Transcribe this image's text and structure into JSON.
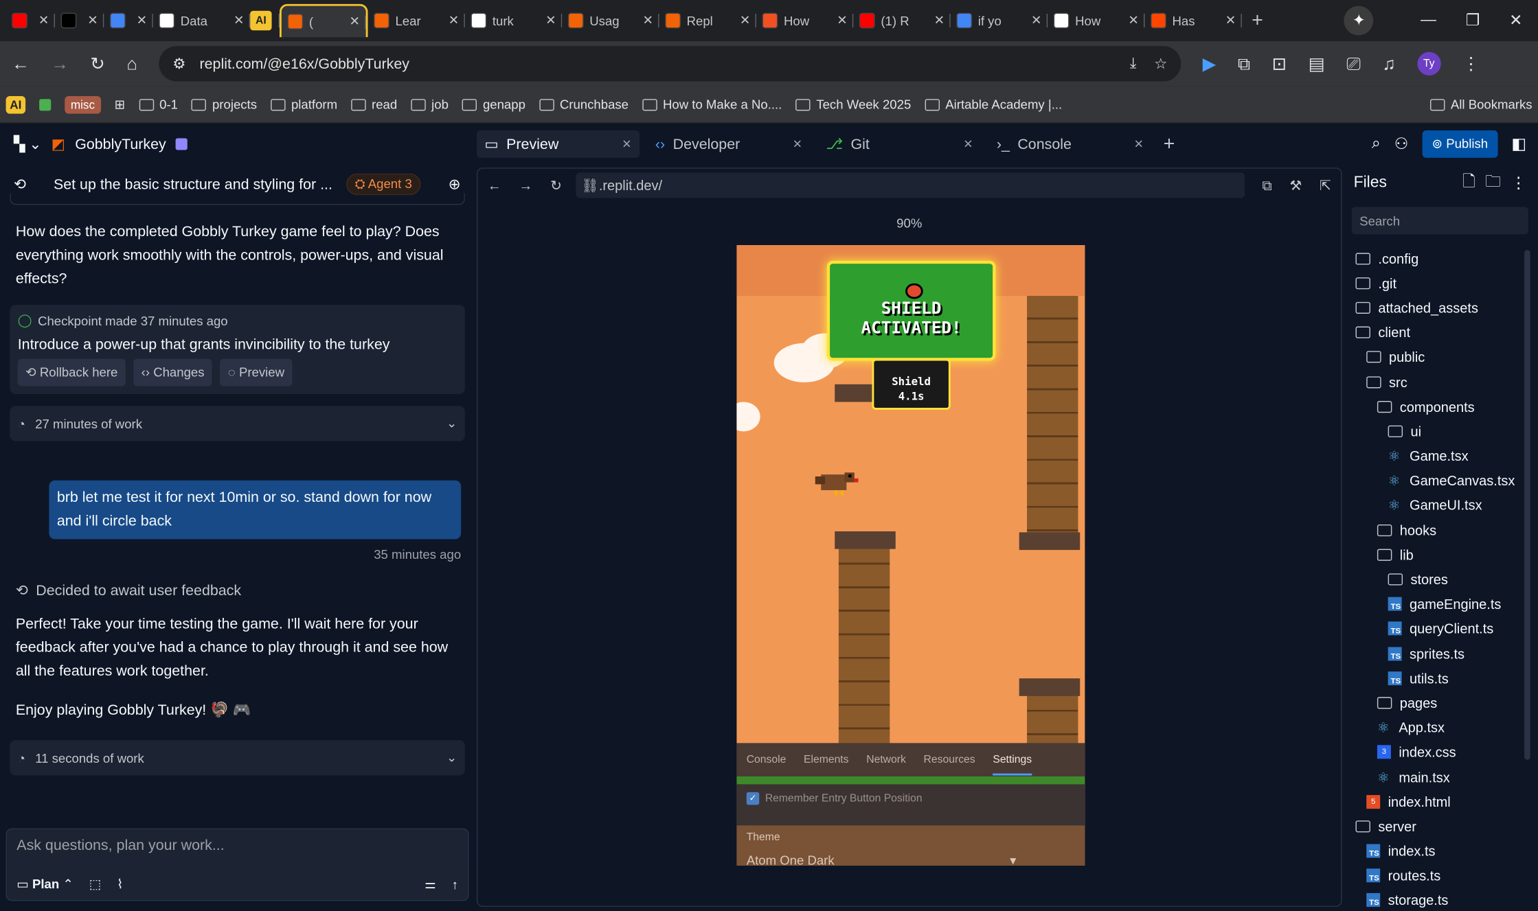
{
  "browser": {
    "tabs": [
      {
        "label": "",
        "icon": "youtube-icon",
        "color": "#ff0000"
      },
      {
        "label": "",
        "icon": "x-icon",
        "color": "#000000"
      },
      {
        "label": "",
        "icon": "gemini-icon",
        "color": "#4285f4"
      },
      {
        "label": "Data",
        "icon": "openai-icon",
        "color": "#ffffff"
      },
      {
        "label": "AI",
        "icon": "ai-group-icon",
        "color": "#f4c430"
      },
      {
        "label": "(",
        "icon": "replit-icon",
        "color": "#f26207"
      },
      {
        "label": "Lear",
        "icon": "replit-icon",
        "color": "#f26207"
      },
      {
        "label": "turk",
        "icon": "github-icon",
        "color": "#ffffff"
      },
      {
        "label": "Usag",
        "icon": "replit-icon",
        "color": "#f26207"
      },
      {
        "label": "Repl",
        "icon": "replit-icon",
        "color": "#f26207"
      },
      {
        "label": "How",
        "icon": "microsoft-icon",
        "color": "#f25022"
      },
      {
        "label": "(1) R",
        "icon": "youtube-icon",
        "color": "#ff0000"
      },
      {
        "label": "if yo",
        "icon": "google-icon",
        "color": "#4285f4"
      },
      {
        "label": "How",
        "icon": "generic-icon",
        "color": "#ffffff"
      },
      {
        "label": "Has",
        "icon": "reddit-icon",
        "color": "#ff4500"
      }
    ],
    "url": "replit.com/@e16x/GobblyTurkey",
    "avatar": "Ty",
    "bookmarks": {
      "ai": "AI",
      "misc": "misc",
      "items": [
        "0-1",
        "projects",
        "platform",
        "read",
        "job",
        "genapp",
        "Crunchbase",
        "How to Make a No....",
        "Tech Week 2025",
        "Airtable Academy |..."
      ],
      "all": "All Bookmarks"
    }
  },
  "left": {
    "project": "GobblyTurkey",
    "thread_title": "Set up the basic structure and styling for ...",
    "agent_badge": "Agent 3",
    "msg1": "How does the completed Gobbly Turkey game feel to play? Does everything work smoothly with the controls, power-ups, and visual effects?",
    "checkpoint": {
      "status": "Checkpoint made 37 minutes ago",
      "title": "Introduce a power-up that grants invincibility to the turkey",
      "rollback": "Rollback here",
      "changes": "Changes",
      "preview": "Preview"
    },
    "work1": "27 minutes of work",
    "user_msg": "brb let me test it for next 10min or so. stand down for now and i'll circle back",
    "user_time": "35 minutes ago",
    "decided": "Decided to await user feedback",
    "msg2": "Perfect! Take your time testing the game. I'll wait here for your feedback after you've had a chance to play through it and see how all the features work together.",
    "msg3": "Enjoy playing Gobbly Turkey! 🦃 🎮",
    "work2": "11 seconds of work",
    "input_placeholder": "Ask questions, plan your work...",
    "plan": "Plan"
  },
  "middle": {
    "tabs": [
      "Preview",
      "Developer",
      "Git",
      "Console"
    ],
    "url": ".replit.dev/",
    "zoom": "90%",
    "game": {
      "banner_line1": "SHIELD",
      "banner_line2": "ACTIVATED!",
      "shield_label": "Shield",
      "shield_time": "4.1s",
      "devtools_tabs": [
        "Console",
        "Elements",
        "Network",
        "Resources",
        "Settings"
      ],
      "setting": "Remember Entry Button Position",
      "theme_label": "Theme",
      "theme_value": "Atom One Dark"
    }
  },
  "right": {
    "publish": "Publish",
    "files_title": "Files",
    "search_placeholder": "Search",
    "tree": [
      {
        "name": ".config",
        "type": "folder",
        "depth": 0
      },
      {
        "name": ".git",
        "type": "folder",
        "depth": 0
      },
      {
        "name": "attached_assets",
        "type": "folder",
        "depth": 0
      },
      {
        "name": "client",
        "type": "folder-open",
        "depth": 0
      },
      {
        "name": "public",
        "type": "folder",
        "depth": 1
      },
      {
        "name": "src",
        "type": "folder-open",
        "depth": 1
      },
      {
        "name": "components",
        "type": "folder-open",
        "depth": 2
      },
      {
        "name": "ui",
        "type": "folder",
        "depth": 3
      },
      {
        "name": "Game.tsx",
        "type": "react",
        "depth": 3
      },
      {
        "name": "GameCanvas.tsx",
        "type": "react",
        "depth": 3
      },
      {
        "name": "GameUI.tsx",
        "type": "react",
        "depth": 3
      },
      {
        "name": "hooks",
        "type": "folder",
        "depth": 2
      },
      {
        "name": "lib",
        "type": "folder-open",
        "depth": 2
      },
      {
        "name": "stores",
        "type": "folder",
        "depth": 3
      },
      {
        "name": "gameEngine.ts",
        "type": "ts",
        "depth": 3
      },
      {
        "name": "queryClient.ts",
        "type": "ts",
        "depth": 3
      },
      {
        "name": "sprites.ts",
        "type": "ts",
        "depth": 3
      },
      {
        "name": "utils.ts",
        "type": "ts",
        "depth": 3
      },
      {
        "name": "pages",
        "type": "folder",
        "depth": 2
      },
      {
        "name": "App.tsx",
        "type": "react",
        "depth": 2
      },
      {
        "name": "index.css",
        "type": "css",
        "depth": 2
      },
      {
        "name": "main.tsx",
        "type": "react",
        "depth": 2
      },
      {
        "name": "index.html",
        "type": "html",
        "depth": 1
      },
      {
        "name": "server",
        "type": "folder-open",
        "depth": 0
      },
      {
        "name": "index.ts",
        "type": "ts",
        "depth": 1
      },
      {
        "name": "routes.ts",
        "type": "ts",
        "depth": 1
      },
      {
        "name": "storage.ts",
        "type": "ts",
        "depth": 1
      }
    ]
  }
}
